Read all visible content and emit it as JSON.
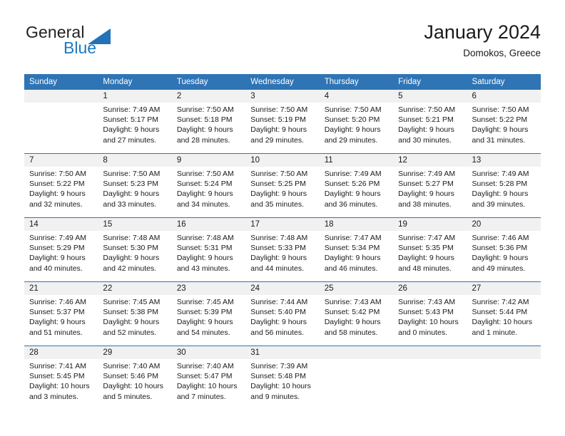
{
  "brand": {
    "name_top": "General",
    "name_bottom": "Blue",
    "color_blue": "#1b79c3",
    "color_dark": "#231f20",
    "triangle_icon": "triangle-icon"
  },
  "header": {
    "title": "January 2024",
    "subtitle": "Domokos, Greece"
  },
  "theme": {
    "header_blue": "#2f74b5",
    "daynum_band": "#f1f1f1",
    "text": "#1a1a1a"
  },
  "calendar": {
    "weekdays": [
      "Sunday",
      "Monday",
      "Tuesday",
      "Wednesday",
      "Thursday",
      "Friday",
      "Saturday"
    ],
    "weeks": [
      {
        "days": [
          {
            "num": "",
            "lines": [
              "",
              "",
              "",
              ""
            ]
          },
          {
            "num": "1",
            "lines": [
              "Sunrise: 7:49 AM",
              "Sunset: 5:17 PM",
              "Daylight: 9 hours",
              "and 27 minutes."
            ]
          },
          {
            "num": "2",
            "lines": [
              "Sunrise: 7:50 AM",
              "Sunset: 5:18 PM",
              "Daylight: 9 hours",
              "and 28 minutes."
            ]
          },
          {
            "num": "3",
            "lines": [
              "Sunrise: 7:50 AM",
              "Sunset: 5:19 PM",
              "Daylight: 9 hours",
              "and 29 minutes."
            ]
          },
          {
            "num": "4",
            "lines": [
              "Sunrise: 7:50 AM",
              "Sunset: 5:20 PM",
              "Daylight: 9 hours",
              "and 29 minutes."
            ]
          },
          {
            "num": "5",
            "lines": [
              "Sunrise: 7:50 AM",
              "Sunset: 5:21 PM",
              "Daylight: 9 hours",
              "and 30 minutes."
            ]
          },
          {
            "num": "6",
            "lines": [
              "Sunrise: 7:50 AM",
              "Sunset: 5:22 PM",
              "Daylight: 9 hours",
              "and 31 minutes."
            ]
          }
        ]
      },
      {
        "days": [
          {
            "num": "7",
            "lines": [
              "Sunrise: 7:50 AM",
              "Sunset: 5:22 PM",
              "Daylight: 9 hours",
              "and 32 minutes."
            ]
          },
          {
            "num": "8",
            "lines": [
              "Sunrise: 7:50 AM",
              "Sunset: 5:23 PM",
              "Daylight: 9 hours",
              "and 33 minutes."
            ]
          },
          {
            "num": "9",
            "lines": [
              "Sunrise: 7:50 AM",
              "Sunset: 5:24 PM",
              "Daylight: 9 hours",
              "and 34 minutes."
            ]
          },
          {
            "num": "10",
            "lines": [
              "Sunrise: 7:50 AM",
              "Sunset: 5:25 PM",
              "Daylight: 9 hours",
              "and 35 minutes."
            ]
          },
          {
            "num": "11",
            "lines": [
              "Sunrise: 7:49 AM",
              "Sunset: 5:26 PM",
              "Daylight: 9 hours",
              "and 36 minutes."
            ]
          },
          {
            "num": "12",
            "lines": [
              "Sunrise: 7:49 AM",
              "Sunset: 5:27 PM",
              "Daylight: 9 hours",
              "and 38 minutes."
            ]
          },
          {
            "num": "13",
            "lines": [
              "Sunrise: 7:49 AM",
              "Sunset: 5:28 PM",
              "Daylight: 9 hours",
              "and 39 minutes."
            ]
          }
        ]
      },
      {
        "days": [
          {
            "num": "14",
            "lines": [
              "Sunrise: 7:49 AM",
              "Sunset: 5:29 PM",
              "Daylight: 9 hours",
              "and 40 minutes."
            ]
          },
          {
            "num": "15",
            "lines": [
              "Sunrise: 7:48 AM",
              "Sunset: 5:30 PM",
              "Daylight: 9 hours",
              "and 42 minutes."
            ]
          },
          {
            "num": "16",
            "lines": [
              "Sunrise: 7:48 AM",
              "Sunset: 5:31 PM",
              "Daylight: 9 hours",
              "and 43 minutes."
            ]
          },
          {
            "num": "17",
            "lines": [
              "Sunrise: 7:48 AM",
              "Sunset: 5:33 PM",
              "Daylight: 9 hours",
              "and 44 minutes."
            ]
          },
          {
            "num": "18",
            "lines": [
              "Sunrise: 7:47 AM",
              "Sunset: 5:34 PM",
              "Daylight: 9 hours",
              "and 46 minutes."
            ]
          },
          {
            "num": "19",
            "lines": [
              "Sunrise: 7:47 AM",
              "Sunset: 5:35 PM",
              "Daylight: 9 hours",
              "and 48 minutes."
            ]
          },
          {
            "num": "20",
            "lines": [
              "Sunrise: 7:46 AM",
              "Sunset: 5:36 PM",
              "Daylight: 9 hours",
              "and 49 minutes."
            ]
          }
        ]
      },
      {
        "days": [
          {
            "num": "21",
            "lines": [
              "Sunrise: 7:46 AM",
              "Sunset: 5:37 PM",
              "Daylight: 9 hours",
              "and 51 minutes."
            ]
          },
          {
            "num": "22",
            "lines": [
              "Sunrise: 7:45 AM",
              "Sunset: 5:38 PM",
              "Daylight: 9 hours",
              "and 52 minutes."
            ]
          },
          {
            "num": "23",
            "lines": [
              "Sunrise: 7:45 AM",
              "Sunset: 5:39 PM",
              "Daylight: 9 hours",
              "and 54 minutes."
            ]
          },
          {
            "num": "24",
            "lines": [
              "Sunrise: 7:44 AM",
              "Sunset: 5:40 PM",
              "Daylight: 9 hours",
              "and 56 minutes."
            ]
          },
          {
            "num": "25",
            "lines": [
              "Sunrise: 7:43 AM",
              "Sunset: 5:42 PM",
              "Daylight: 9 hours",
              "and 58 minutes."
            ]
          },
          {
            "num": "26",
            "lines": [
              "Sunrise: 7:43 AM",
              "Sunset: 5:43 PM",
              "Daylight: 10 hours",
              "and 0 minutes."
            ]
          },
          {
            "num": "27",
            "lines": [
              "Sunrise: 7:42 AM",
              "Sunset: 5:44 PM",
              "Daylight: 10 hours",
              "and 1 minute."
            ]
          }
        ]
      },
      {
        "days": [
          {
            "num": "28",
            "lines": [
              "Sunrise: 7:41 AM",
              "Sunset: 5:45 PM",
              "Daylight: 10 hours",
              "and 3 minutes."
            ]
          },
          {
            "num": "29",
            "lines": [
              "Sunrise: 7:40 AM",
              "Sunset: 5:46 PM",
              "Daylight: 10 hours",
              "and 5 minutes."
            ]
          },
          {
            "num": "30",
            "lines": [
              "Sunrise: 7:40 AM",
              "Sunset: 5:47 PM",
              "Daylight: 10 hours",
              "and 7 minutes."
            ]
          },
          {
            "num": "31",
            "lines": [
              "Sunrise: 7:39 AM",
              "Sunset: 5:48 PM",
              "Daylight: 10 hours",
              "and 9 minutes."
            ]
          },
          {
            "num": "",
            "lines": [
              "",
              "",
              "",
              ""
            ]
          },
          {
            "num": "",
            "lines": [
              "",
              "",
              "",
              ""
            ]
          },
          {
            "num": "",
            "lines": [
              "",
              "",
              "",
              ""
            ]
          }
        ]
      }
    ]
  }
}
